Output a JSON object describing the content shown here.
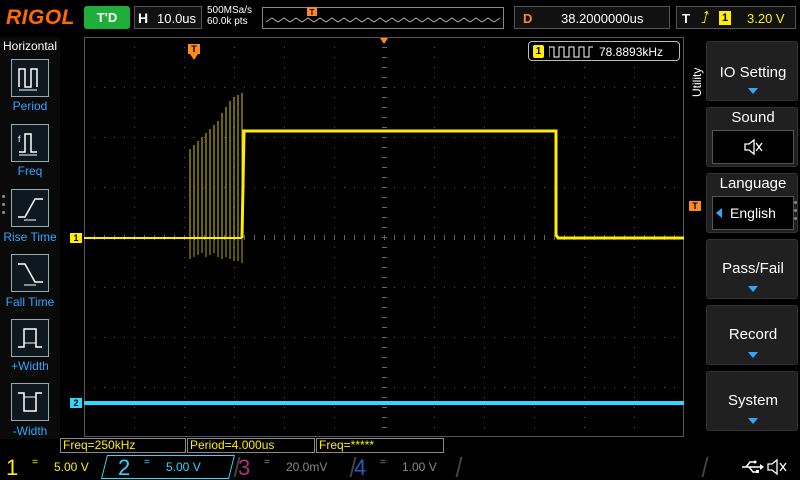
{
  "header": {
    "brand": "RIGOL",
    "run_state": "T'D",
    "timebase_label": "H",
    "timebase_value": "10.0us",
    "sample_rate": "500MSa/s",
    "memory_depth": "60.0k pts",
    "delay_label": "D",
    "delay_value": "38.2000000us",
    "trigger_label": "T",
    "trigger_source": "1",
    "trigger_level": "3.20 V"
  },
  "left_menu": {
    "title": "Horizontal",
    "items": [
      {
        "label": "Period",
        "icon": "period-icon"
      },
      {
        "label": "Freq",
        "icon": "freq-icon"
      },
      {
        "label": "Rise Time",
        "icon": "rise-time-icon"
      },
      {
        "label": "Fall Time",
        "icon": "fall-time-icon"
      },
      {
        "label": "+Width",
        "icon": "pos-width-icon"
      },
      {
        "label": "-Width",
        "icon": "neg-width-icon"
      }
    ]
  },
  "screen": {
    "freq_counter_channel": "1",
    "freq_counter_value": "78.8893kHz",
    "ch1_marker": "1",
    "ch2_marker": "2",
    "trigger_marker": "T",
    "trig_level_marker": "T"
  },
  "measurements": [
    {
      "text": "Freq=250kHz"
    },
    {
      "text": "Period=4.000us"
    },
    {
      "text": "Freq=*****"
    }
  ],
  "channels": [
    {
      "num": "1",
      "coupling": "=",
      "scale": "5.00 V",
      "color": "#ffee00"
    },
    {
      "num": "2",
      "coupling": "=",
      "scale": "5.00 V",
      "color": "#2fd8ff"
    },
    {
      "num": "3",
      "coupling": "=",
      "scale": "20.0mV",
      "color": "#b0307a"
    },
    {
      "num": "4",
      "coupling": "=",
      "scale": "1.00 V",
      "color": "#2060c0"
    }
  ],
  "right_menu": {
    "title": "Utility",
    "items": [
      {
        "label": "IO Setting"
      },
      {
        "label": "Sound",
        "value_icon": "speaker-icon"
      },
      {
        "label": "Language",
        "value": "English"
      },
      {
        "label": "Pass/Fail"
      },
      {
        "label": "Record"
      },
      {
        "label": "System"
      }
    ]
  },
  "status_icons": [
    "usb-icon",
    "speaker-icon"
  ],
  "colors": {
    "ch1": "#ffee00",
    "ch2": "#2fd8ff",
    "accent": "#2fa8ff",
    "trigger": "#ff8a1f",
    "brand": "#ff6a00"
  }
}
